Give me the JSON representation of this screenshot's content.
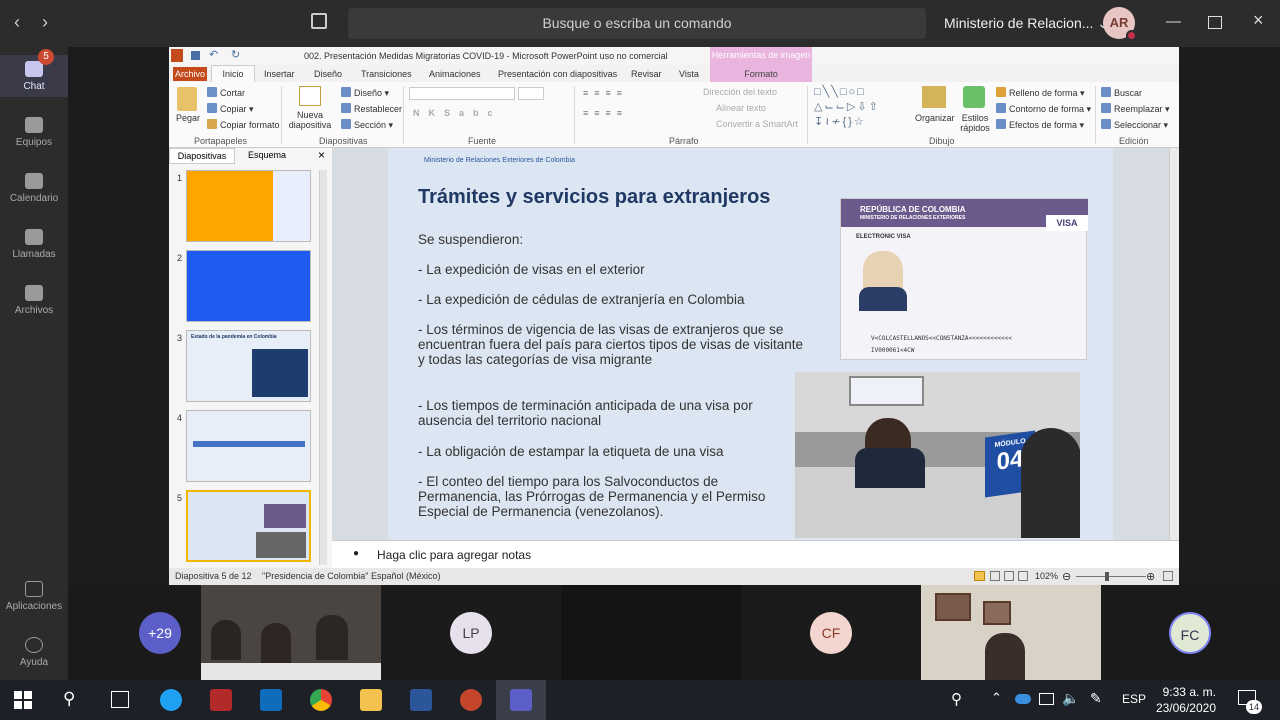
{
  "teams": {
    "search_placeholder": "Busque o escriba un comando",
    "org_name": "Ministerio de Relacion...",
    "user_initials": "AR",
    "rail": [
      {
        "label": "Chat",
        "badge": "5"
      },
      {
        "label": "Equipos"
      },
      {
        "label": "Calendario"
      },
      {
        "label": "Llamadas"
      },
      {
        "label": "Archivos"
      },
      {
        "label": "Aplicaciones"
      },
      {
        "label": "Ayuda"
      }
    ],
    "participants": {
      "more_count": "+29",
      "p1": "LP",
      "p2": "CF",
      "p3": "FC"
    }
  },
  "ppt": {
    "title": "002. Presentación Medidas Migratorias COVID-19 - Microsoft PowerPoint uso no comercial",
    "tools_tab": "Herramientas de imagen",
    "tools_sub": "Formato",
    "tabs": [
      "Archivo",
      "Inicio",
      "Insertar",
      "Diseño",
      "Transiciones",
      "Animaciones",
      "Presentación con diapositivas",
      "Revisar",
      "Vista"
    ],
    "ribbon": {
      "pegar": "Pegar",
      "cortar": "Cortar",
      "copiar": "Copiar",
      "copiar_formato": "Copiar formato",
      "portapapeles": "Portapapeles",
      "nueva_diap": "Nueva diapositiva",
      "diseno": "Diseño",
      "restablecer": "Restablecer",
      "seccion": "Sección",
      "diapositivas": "Diapositivas",
      "fuente": "Fuente",
      "direccion_texto": "Dirección del texto",
      "alinear_texto": "Alinear texto",
      "convertir_smartart": "Convertir a SmartArt",
      "parrafo": "Párrafo",
      "organizar": "Organizar",
      "estilos": "Estilos rápidos",
      "relleno": "Relleno de forma",
      "contorno": "Contorno de forma",
      "efectos": "Efectos de forma",
      "dibujo": "Dibujo",
      "buscar": "Buscar",
      "reemplazar": "Reemplazar",
      "seleccionar": "Seleccionar",
      "edicion": "Edición"
    },
    "pane_tabs": [
      "Diapositivas",
      "Esquema"
    ],
    "thumb3_title": "Estado de la pandemia en Colombia",
    "slide": {
      "kicker": "Ministerio de Relaciones Exteriores de Colombia",
      "title": "Trámites y servicios para extranjeros",
      "bullets": [
        "Se suspendieron:",
        "- La expedición de visas en el exterior",
        "- La expedición de cédulas de extranjería en Colombia",
        "- Los términos de vigencia de las visas de extranjeros que se encuentran fuera del país para ciertos tipos de visas de visitante y todas las categorías de visa migrante",
        "- Los tiempos de terminación anticipada de una visa por ausencia del territorio nacional",
        "- La obligación de estampar la etiqueta de una visa",
        "- El conteo del tiempo para los Salvoconductos de Permanencia, las Prórrogas de Permanencia y el Permiso Especial de Permanencia (venezolanos)."
      ],
      "visa_header": "REPÚBLICA DE COLOMBIA",
      "visa_sub": "MINISTERIO DE RELACIONES EXTERIORES",
      "visa_tag": "VISA",
      "visa_label": "ELECTRONIC VISA",
      "visa_mrz1": "V<COLCASTELLANOS<<CONSTANZA<<<<<<<<<<<<",
      "visa_mrz2": "IV000061<4CW",
      "photo_sign": "MÓDULO",
      "photo_num": "04"
    },
    "notes": "Haga clic para agregar notas",
    "status": {
      "slide": "Diapositiva 5 de 12",
      "theme": "\"Presidencia de Colombia\"",
      "lang": "Español (México)",
      "zoom": "102%"
    }
  },
  "taskbar": {
    "lang": "ESP",
    "time": "9:33 a. m.",
    "date": "23/06/2020",
    "notif": "14"
  }
}
